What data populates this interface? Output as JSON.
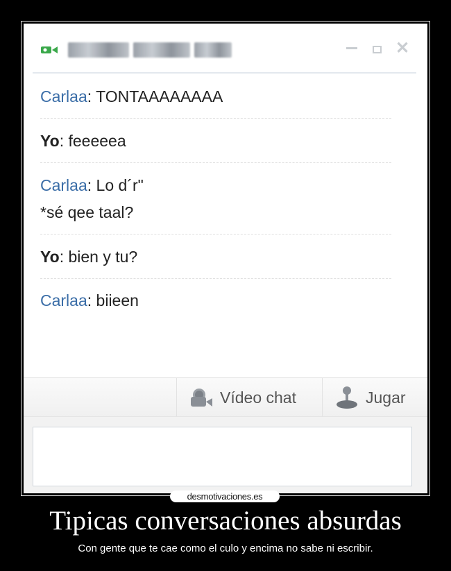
{
  "chat": {
    "messages": [
      {
        "sender": "Carlaa",
        "text": ": TONTAAAAAAAA",
        "self": false
      },
      {
        "sender": "Yo",
        "text": ": feeeeea",
        "self": true
      },
      {
        "sender": "Carlaa",
        "text": ": Lo d´r\"",
        "extra": "*sé qee taal?",
        "self": false
      },
      {
        "sender": "Yo",
        "text": ": bien y tu?",
        "self": true
      },
      {
        "sender": "Carlaa",
        "text": ": biieen",
        "self": false
      }
    ],
    "toolbar": {
      "video_label": "Vídeo chat",
      "game_label": "Jugar"
    },
    "input_value": ""
  },
  "poster": {
    "watermark": "desmotivaciones.es",
    "title": "Tipicas conversaciones absurdas",
    "subtitle": "Con gente que te cae como el culo y encima no sabe ni escribir."
  },
  "colors": {
    "sender_other": "#3a6da7",
    "camera_icon": "#3aa84a"
  }
}
